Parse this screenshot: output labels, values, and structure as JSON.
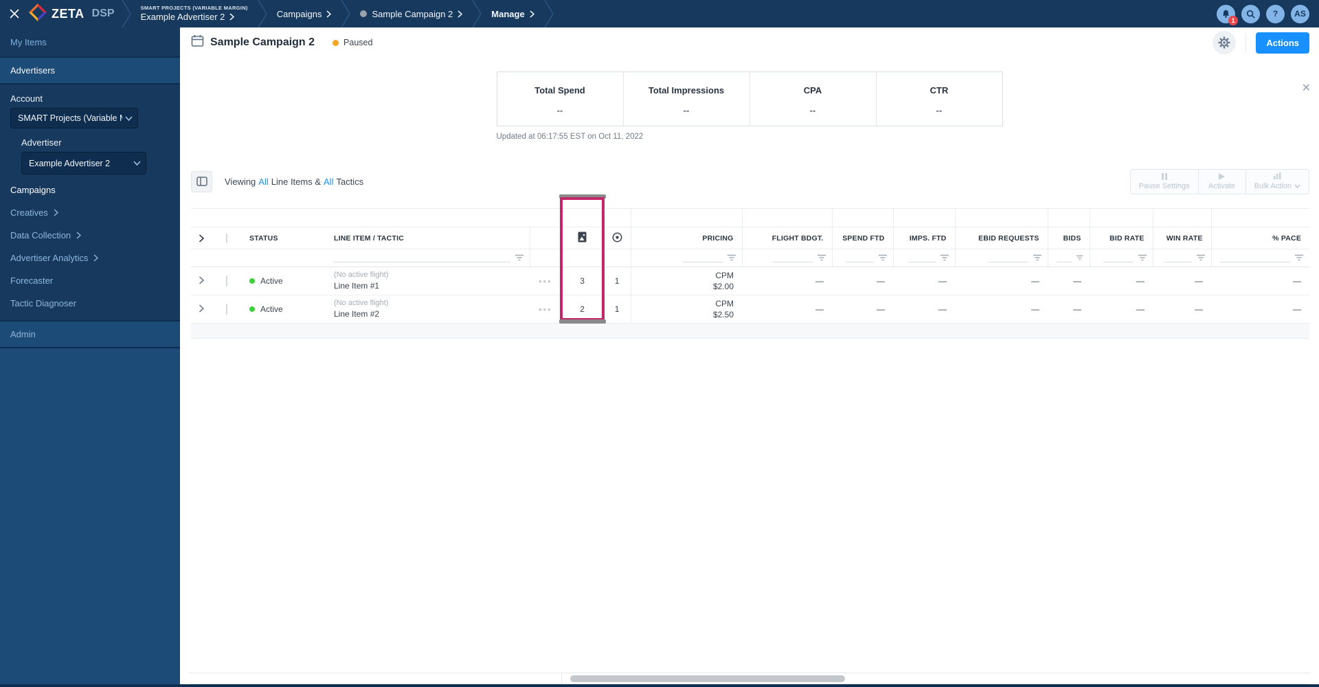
{
  "topbar": {
    "brand": "ZETA",
    "product": "DSP",
    "breadcrumb": {
      "account_super": "SMART PROJECTS (VARIABLE MARGIN)",
      "account": "Example Advertiser 2",
      "campaigns": "Campaigns",
      "campaign": "Sample Campaign 2",
      "manage": "Manage"
    },
    "notification_count": "1",
    "help": "?",
    "avatar": "AS"
  },
  "sidebar": {
    "my_items": "My Items",
    "advertisers": "Advertisers",
    "account_label": "Account",
    "account_value": "SMART Projects (Variable M",
    "advertiser_label": "Advertiser",
    "advertiser_value": "Example Advertiser 2",
    "nav": [
      {
        "label": "Campaigns"
      },
      {
        "label": "Creatives"
      },
      {
        "label": "Data Collection"
      },
      {
        "label": "Advertiser Analytics"
      },
      {
        "label": "Forecaster"
      },
      {
        "label": "Tactic Diagnoser"
      }
    ],
    "admin": "Admin"
  },
  "header": {
    "title": "Sample Campaign 2",
    "status": "Paused",
    "actions_label": "Actions"
  },
  "stats": {
    "items": [
      {
        "label": "Total Spend",
        "value": "--"
      },
      {
        "label": "Total Impressions",
        "value": "--"
      },
      {
        "label": "CPA",
        "value": "--"
      },
      {
        "label": "CTR",
        "value": "--"
      }
    ],
    "updated": "Updated at 06:17:55 EST on Oct 11, 2022"
  },
  "toolbar": {
    "viewing_prefix": "Viewing",
    "all_line_items": "All",
    "viewing_mid": "Line Items &",
    "all_tactics": "All",
    "viewing_suffix": "Tactics",
    "pause_settings": "Pause Settings",
    "activate": "Activate",
    "bulk_action": "Bulk Action"
  },
  "table": {
    "columns": {
      "status": "STATUS",
      "line_item": "LINE ITEM / TACTIC",
      "pricing": "PRICING",
      "flight_bdgt": "FLIGHT BDGT.",
      "spend_ftd": "SPEND FTD",
      "imps_ftd": "IMPS. FTD",
      "ebid_requests": "EBID REQUESTS",
      "bids": "BIDS",
      "bid_rate": "BID RATE",
      "win_rate": "WIN RATE",
      "pace": "% PACE"
    },
    "rows": [
      {
        "status": "Active",
        "flight_note": "(No active flight)",
        "name": "Line Item #1",
        "creatives": "3",
        "tactics": "1",
        "pricing_model": "CPM",
        "pricing_value": "$2.00",
        "metrics": [
          "—",
          "—",
          "—",
          "—",
          "—",
          "—",
          "—",
          "—"
        ]
      },
      {
        "status": "Active",
        "flight_note": "(No active flight)",
        "name": "Line Item #2",
        "creatives": "2",
        "tactics": "1",
        "pricing_model": "CPM",
        "pricing_value": "$2.50",
        "metrics": [
          "—",
          "—",
          "—",
          "—",
          "—",
          "—",
          "—",
          "—"
        ]
      }
    ]
  }
}
